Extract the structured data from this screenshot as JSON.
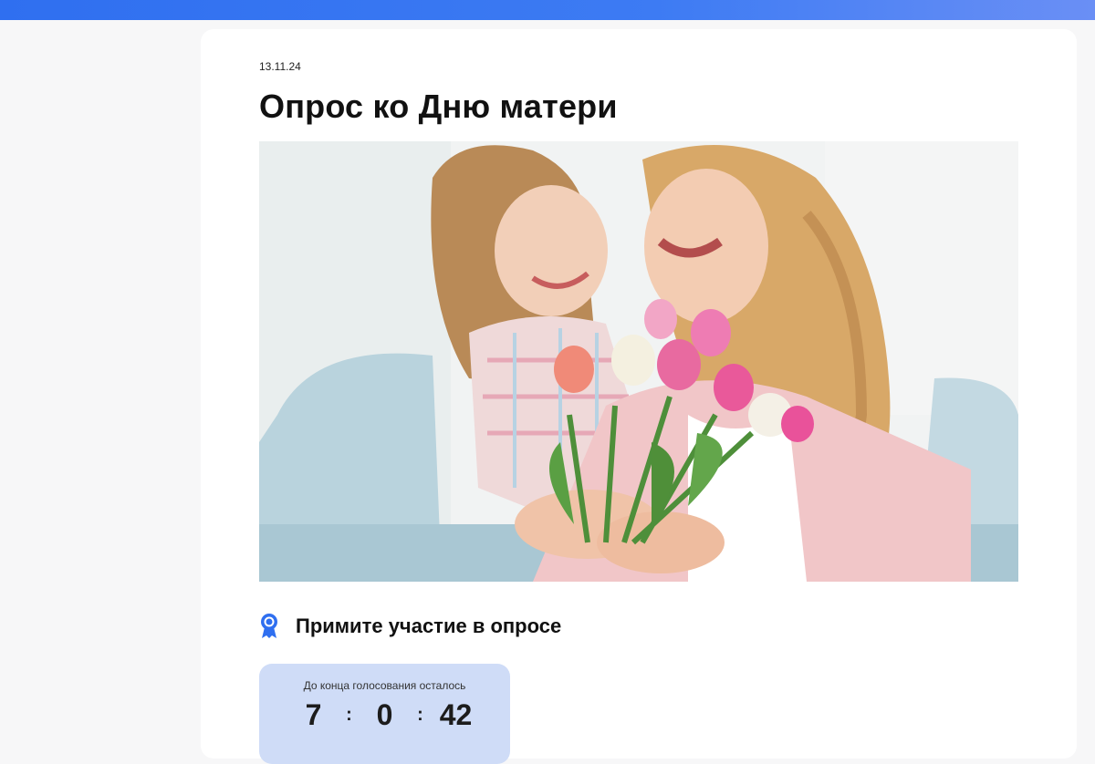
{
  "article": {
    "date": "13.11.24",
    "title": "Опрос ко Дню матери"
  },
  "image": {
    "description_icon": "photo-mother-daughter-tulips"
  },
  "survey": {
    "icon": "award-ribbon-icon",
    "title": "Примите участие в опросе"
  },
  "timer": {
    "label": "До конца голосования осталось",
    "days": "7",
    "hours": "0",
    "minutes": "42",
    "separator": ":"
  },
  "colors": {
    "top_bar": "#2f6ff0",
    "timer_background": "#cfdcf7",
    "accent": "#2f6ff0"
  }
}
